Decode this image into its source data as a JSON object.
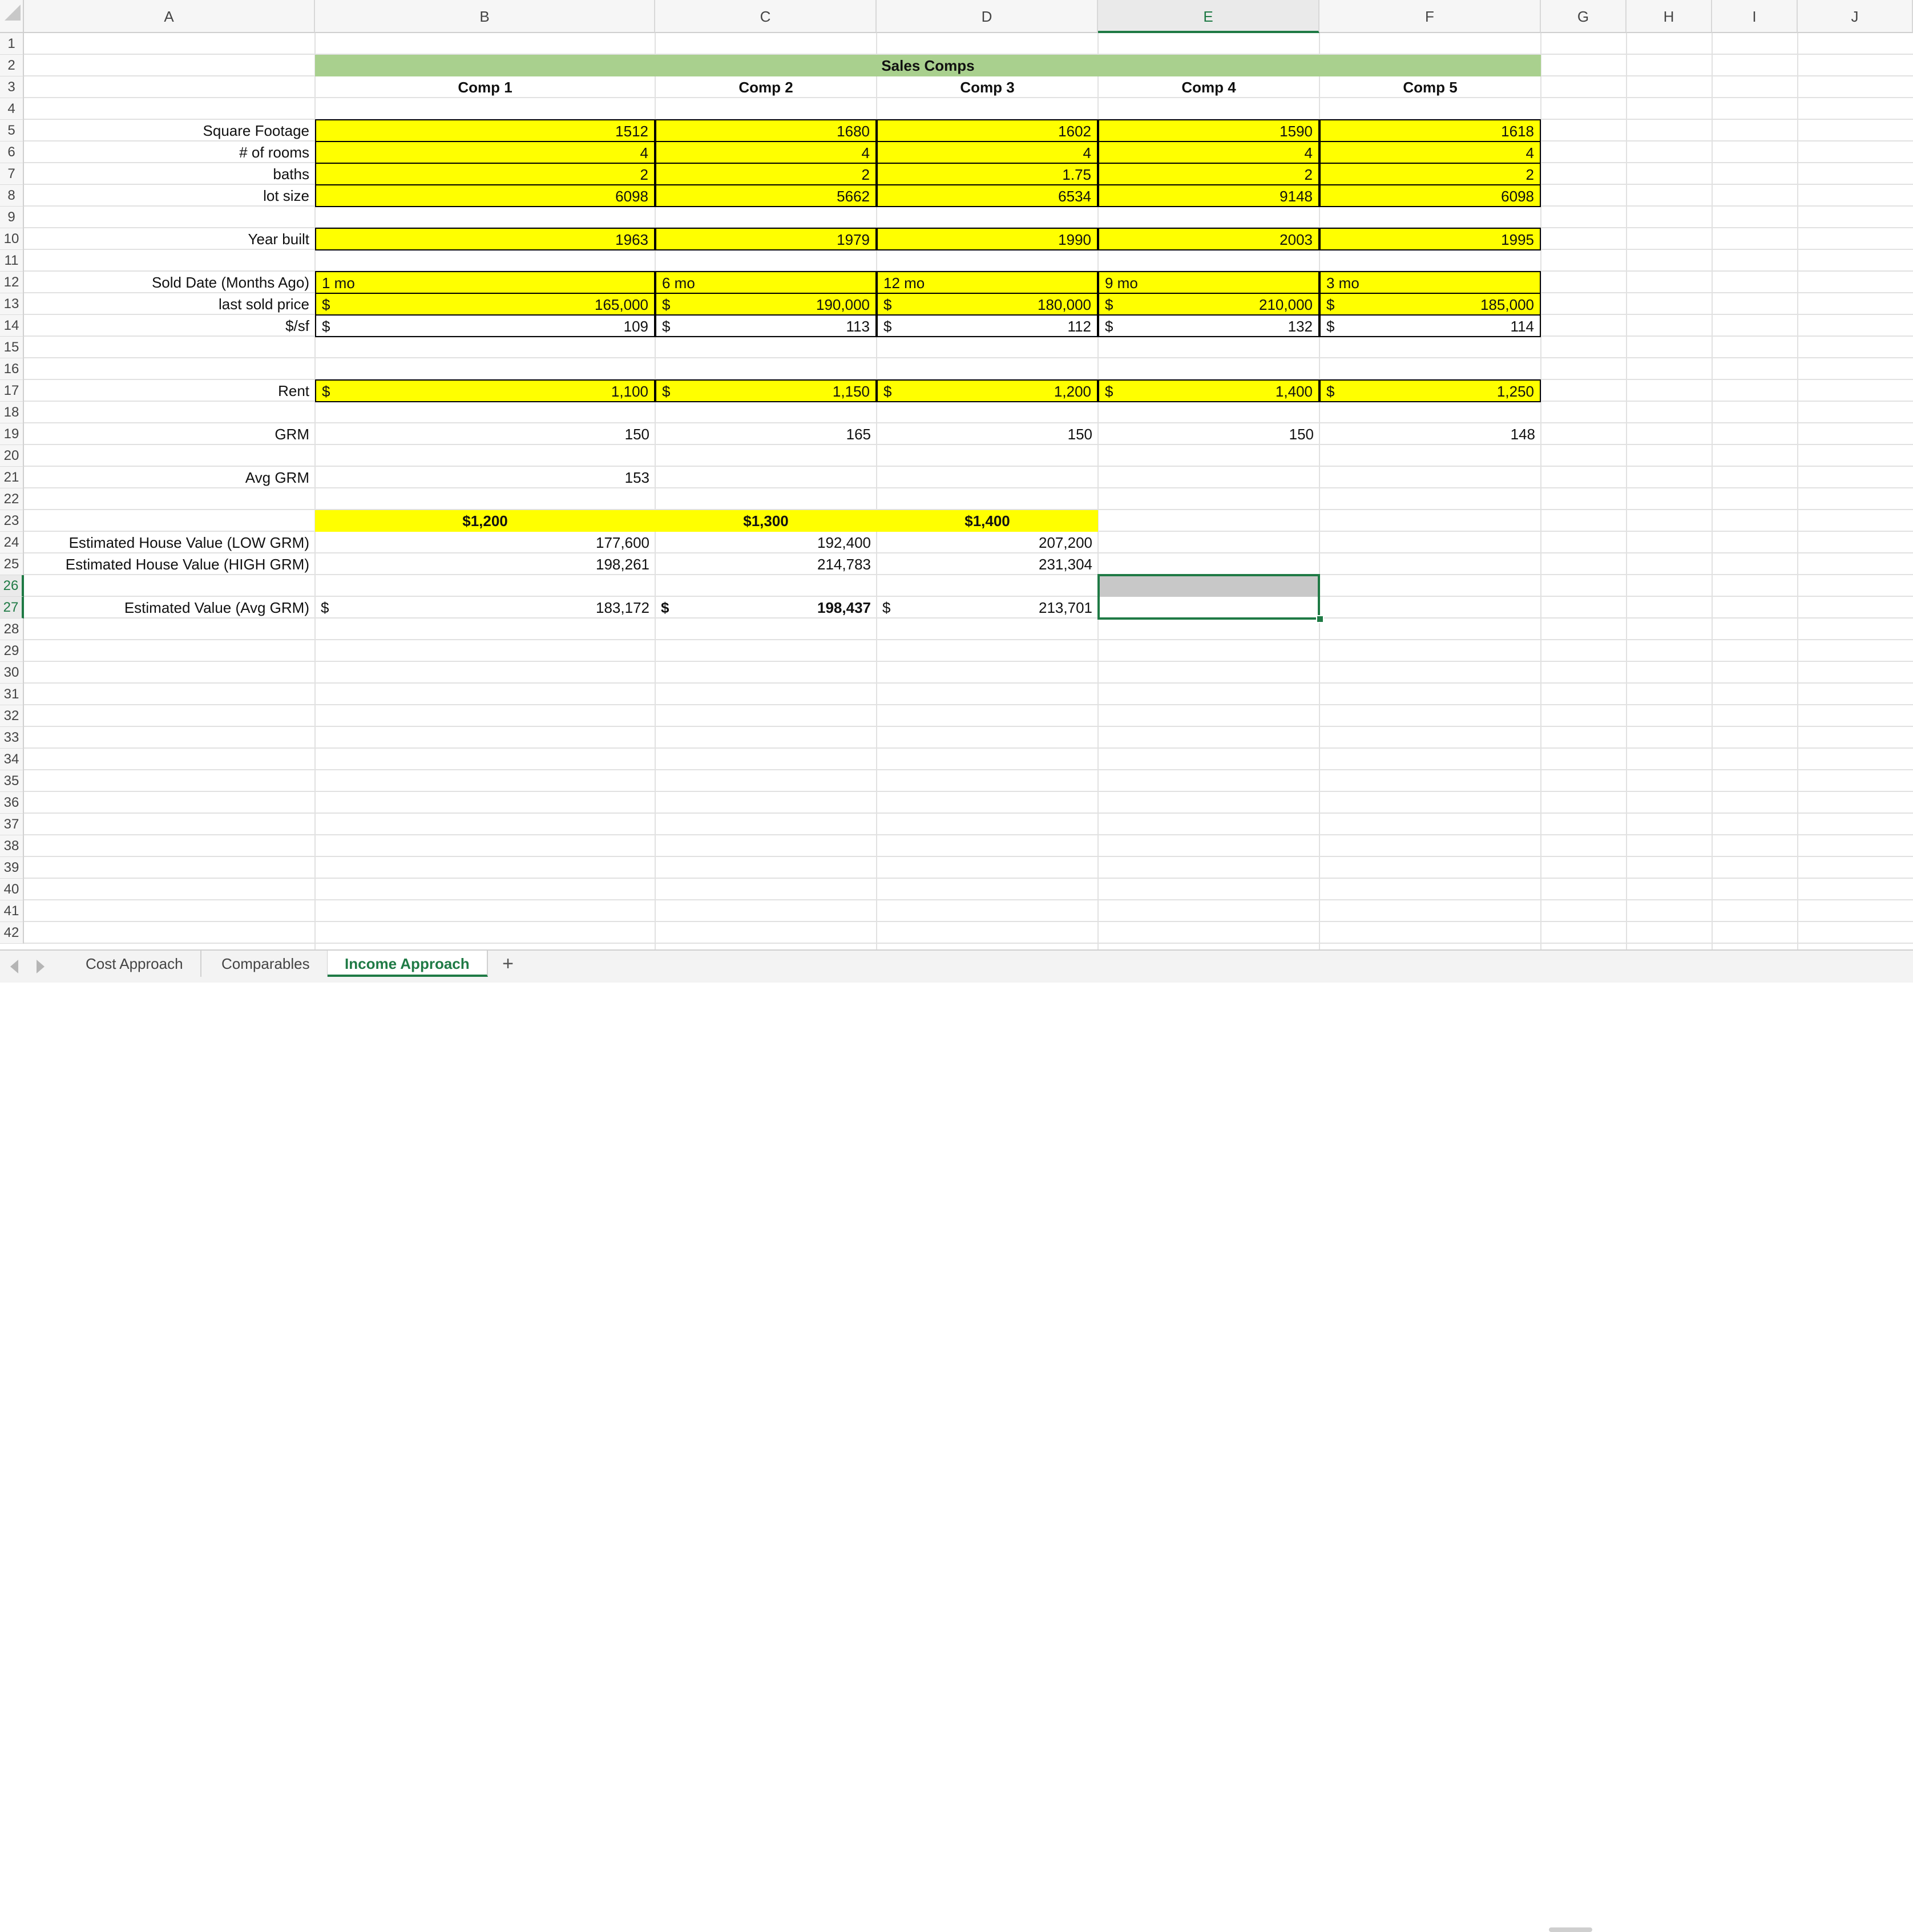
{
  "columns": [
    "A",
    "B",
    "C",
    "D",
    "E",
    "F",
    "G",
    "H",
    "I",
    "J"
  ],
  "rows": [
    "1",
    "2",
    "3",
    "4",
    "5",
    "6",
    "7",
    "8",
    "9",
    "10",
    "11",
    "12",
    "13",
    "14",
    "15",
    "16",
    "17",
    "18",
    "19",
    "20",
    "21",
    "22",
    "23",
    "24",
    "25",
    "26",
    "27",
    "28",
    "29",
    "30",
    "31",
    "32",
    "33",
    "34",
    "35",
    "36",
    "37",
    "38",
    "39",
    "40",
    "41",
    "42"
  ],
  "selected_column": "E",
  "selected_rows": [
    "26",
    "27"
  ],
  "title": "Sales Comps",
  "comps": [
    "Comp 1",
    "Comp 2",
    "Comp 3",
    "Comp 4",
    "Comp 5"
  ],
  "labels": {
    "sqft": "Square Footage",
    "rooms": "# of rooms",
    "baths": "baths",
    "lot": "lot size",
    "year": "Year built",
    "sold": "Sold Date (Months Ago)",
    "price": "last sold price",
    "psf": "$/sf",
    "rent": "Rent",
    "grm": "GRM",
    "avg_grm": "Avg GRM",
    "low": "Estimated House Value (LOW GRM)",
    "high": "Estimated House Value (HIGH GRM)",
    "avg_value": "Estimated Value (Avg GRM)"
  },
  "currency_symbol": "$",
  "data": {
    "sqft": [
      "1512",
      "1680",
      "1602",
      "1590",
      "1618"
    ],
    "rooms": [
      "4",
      "4",
      "4",
      "4",
      "4"
    ],
    "baths": [
      "2",
      "2",
      "1.75",
      "2",
      "2"
    ],
    "lot": [
      "6098",
      "5662",
      "6534",
      "9148",
      "6098"
    ],
    "year": [
      "1963",
      "1979",
      "1990",
      "2003",
      "1995"
    ],
    "sold": [
      "1 mo",
      "6 mo",
      "12 mo",
      "9 mo",
      "3 mo"
    ],
    "price": [
      "165,000",
      "190,000",
      "180,000",
      "210,000",
      "185,000"
    ],
    "psf": [
      "109",
      "113",
      "112",
      "132",
      "114"
    ],
    "rent": [
      "1,100",
      "1,150",
      "1,200",
      "1,400",
      "1,250"
    ],
    "grm": [
      "150",
      "165",
      "150",
      "150",
      "148"
    ],
    "avg_grm": "153",
    "rent_scenarios": [
      "$1,200",
      "$1,300",
      "$1,400"
    ],
    "low": [
      "177,600",
      "192,400",
      "207,200"
    ],
    "high": [
      "198,261",
      "214,783",
      "231,304"
    ],
    "avg_value": [
      "183,172",
      "198,437",
      "213,701"
    ]
  },
  "tabs": [
    "Cost Approach",
    "Comparables",
    "Income Approach"
  ],
  "active_tab": "Income Approach",
  "add_tab_label": "+",
  "colors": {
    "yellow": "#ffff00",
    "green": "#a9d08e",
    "accent": "#1f7a45",
    "selection_fill": "#c8c8c8"
  }
}
